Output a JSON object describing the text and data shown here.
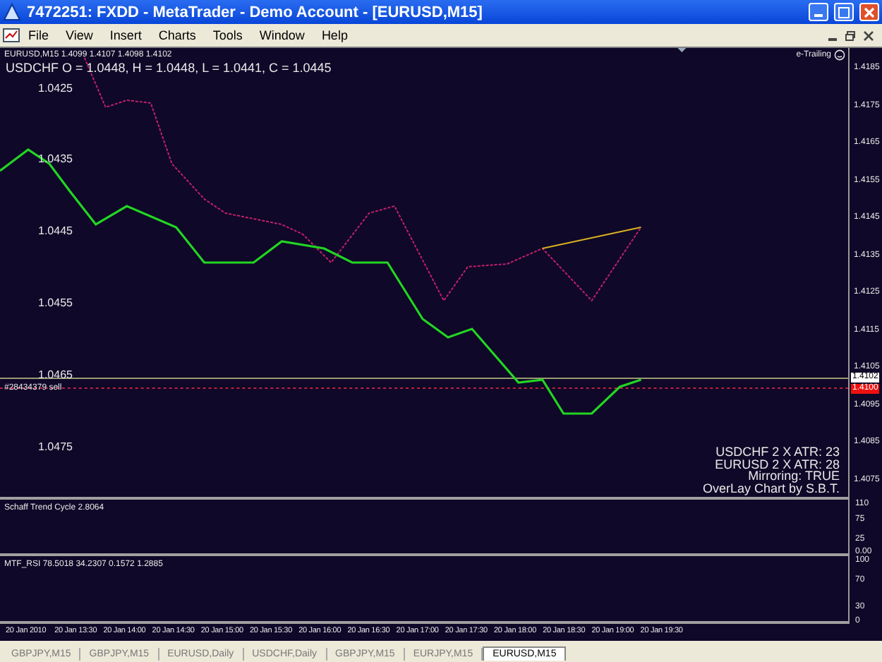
{
  "window": {
    "title": "7472251: FXDD - MetaTrader - Demo Account - [EURUSD,M15]"
  },
  "menu": [
    "File",
    "View",
    "Insert",
    "Charts",
    "Tools",
    "Window",
    "Help"
  ],
  "chart": {
    "header": "EURUSD,M15  1.4099 1.4107 1.4098 1.4102",
    "overlay_ohlc": "USDCHF O = 1.0448, H = 1.0448, L = 1.0441, C = 1.0445",
    "expert": "e-Trailing",
    "overlay_levels": [
      "1.0425",
      "1.0435",
      "1.0445",
      "1.0455",
      "1.0465",
      "1.0475"
    ],
    "order_label": "#28434379 sell",
    "price_axis": [
      "1.4185",
      "1.4175",
      "1.4165",
      "1.4155",
      "1.4145",
      "1.4135",
      "1.4125",
      "1.4115",
      "1.4105",
      "1.4095",
      "1.4085",
      "1.4075"
    ],
    "bid_price": "1.4102",
    "order_price": "1.4100",
    "info_lines": [
      "USDCHF 2 X ATR: 23",
      "EURUSD 2 X ATR: 28",
      "Mirroring: TRUE",
      "OverLay Chart by S.B.T."
    ]
  },
  "indicators": [
    {
      "title": "Schaff Trend Cycle 2.8064",
      "axis": [
        "110",
        "75",
        "25",
        "0.00"
      ]
    },
    {
      "title": "MTF_RSI 78.5018 34.2307 0.1572 1.2885",
      "axis": [
        "100",
        "70",
        "30",
        "0"
      ]
    }
  ],
  "time_axis": [
    "20 Jan 2010",
    "20 Jan 13:30",
    "20 Jan 14:00",
    "20 Jan 14:30",
    "20 Jan 15:00",
    "20 Jan 15:30",
    "20 Jan 16:00",
    "20 Jan 16:30",
    "20 Jan 17:00",
    "20 Jan 17:30",
    "20 Jan 18:00",
    "20 Jan 18:30",
    "20 Jan 19:00",
    "20 Jan 19:30"
  ],
  "tabs": [
    {
      "label": "GBPJPY,M15",
      "selected": false
    },
    {
      "label": "GBPJPY,M15",
      "selected": false
    },
    {
      "label": "EURUSD,Daily",
      "selected": false
    },
    {
      "label": "USDCHF,Daily",
      "selected": false
    },
    {
      "label": "GBPJPY,M15",
      "selected": false
    },
    {
      "label": "EURJPY,M15",
      "selected": false
    },
    {
      "label": "EURUSD,M15",
      "selected": true
    }
  ]
}
